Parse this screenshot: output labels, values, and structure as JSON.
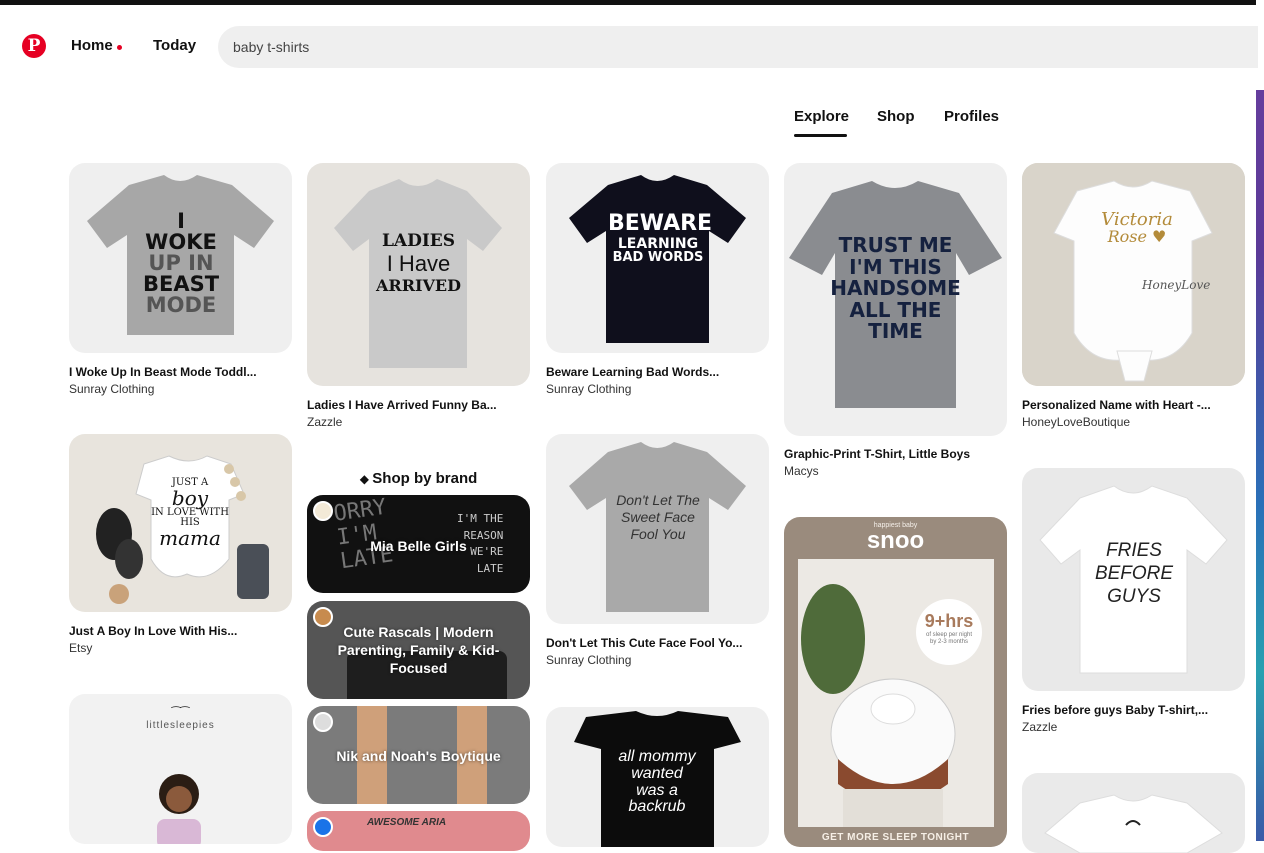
{
  "app": {
    "logo_letter": "P"
  },
  "nav": {
    "home": "Home",
    "today": "Today"
  },
  "search": {
    "value": "baby t-shirts"
  },
  "tabs": [
    "Explore",
    "Shop",
    "Profiles"
  ],
  "pins": [
    {
      "title": "I Woke Up In Beast Mode Toddl...",
      "source": "Sunray Clothing",
      "shirt_lines": [
        "I WOKE",
        "UP IN",
        "BEAST",
        "MODE"
      ]
    },
    {
      "title": "Ladies I Have Arrived Funny Ba...",
      "source": "Zazzle",
      "shirt_lines": [
        "LADIES",
        "I Have",
        "ARRIVED"
      ]
    },
    {
      "title": "Beware Learning Bad Words...",
      "source": "Sunray Clothing",
      "shirt_lines": [
        "BEWARE",
        "LEARNING",
        "BAD WORDS"
      ]
    },
    {
      "title": "Graphic-Print T-Shirt, Little Boys",
      "source": "Macys",
      "shirt_lines": [
        "TRUST ME",
        "I'M THIS",
        "HANDSOME",
        "ALL THE TIME"
      ]
    },
    {
      "title": "Personalized Name with Heart -...",
      "source": "HoneyLoveBoutique",
      "shirt_lines": [
        "Victoria",
        "Rose",
        "HoneyLove"
      ]
    },
    {
      "title": "Just A Boy In Love With His...",
      "source": "Etsy",
      "shirt_lines": [
        "JUST A",
        "boy",
        "IN LOVE WITH",
        "HIS",
        "mama"
      ]
    },
    {
      "title": "Don't Let This Cute Face Fool Yo...",
      "source": "Sunray Clothing",
      "shirt_lines": [
        "Don't Let The",
        "Sweet Face",
        "Fool You"
      ]
    },
    {
      "title": "Fries before guys Baby T-shirt,...",
      "source": "Zazzle",
      "shirt_lines": [
        "FRIES",
        "BEFORE",
        "GUYS"
      ]
    },
    {
      "brand_text": "littlesleepies"
    },
    {
      "shirt_lines": [
        "all mommy",
        "wanted",
        "was a",
        "backrub"
      ]
    }
  ],
  "ad": {
    "brand": "snoo",
    "tagline_top": "happiest baby",
    "stat": "9+hrs",
    "stat_sub": "of sleep per night by 2-3 months",
    "cta": "GET MORE SLEEP TONIGHT"
  },
  "shop_by_brand": {
    "title": "Shop by brand",
    "brands": [
      {
        "name": "Mia Belle Girls",
        "bg_text": "SORRY I'M LATE / I'M THE REASON WE'RE LATE"
      },
      {
        "name": "Cute Rascals | Modern Parenting, Family & Kid-Focused"
      },
      {
        "name": "Nik and Noah's Boytique"
      },
      {
        "name": "AWESOME ARIA"
      }
    ]
  },
  "colors": {
    "brand_red": "#e60023"
  }
}
